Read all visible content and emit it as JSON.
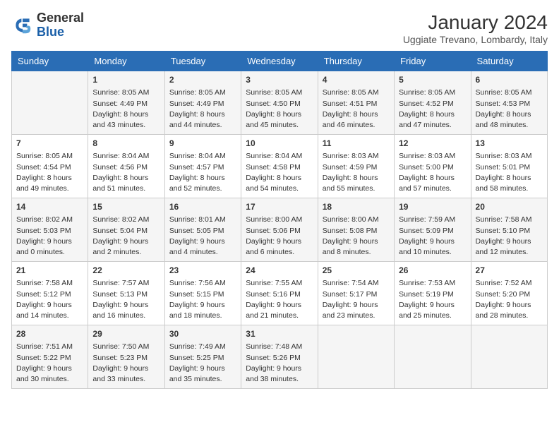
{
  "header": {
    "logo_line1": "General",
    "logo_line2": "Blue",
    "month": "January 2024",
    "location": "Uggiate Trevano, Lombardy, Italy"
  },
  "weekdays": [
    "Sunday",
    "Monday",
    "Tuesday",
    "Wednesday",
    "Thursday",
    "Friday",
    "Saturday"
  ],
  "weeks": [
    [
      {
        "day": "",
        "info": ""
      },
      {
        "day": "1",
        "info": "Sunrise: 8:05 AM\nSunset: 4:49 PM\nDaylight: 8 hours\nand 43 minutes."
      },
      {
        "day": "2",
        "info": "Sunrise: 8:05 AM\nSunset: 4:49 PM\nDaylight: 8 hours\nand 44 minutes."
      },
      {
        "day": "3",
        "info": "Sunrise: 8:05 AM\nSunset: 4:50 PM\nDaylight: 8 hours\nand 45 minutes."
      },
      {
        "day": "4",
        "info": "Sunrise: 8:05 AM\nSunset: 4:51 PM\nDaylight: 8 hours\nand 46 minutes."
      },
      {
        "day": "5",
        "info": "Sunrise: 8:05 AM\nSunset: 4:52 PM\nDaylight: 8 hours\nand 47 minutes."
      },
      {
        "day": "6",
        "info": "Sunrise: 8:05 AM\nSunset: 4:53 PM\nDaylight: 8 hours\nand 48 minutes."
      }
    ],
    [
      {
        "day": "7",
        "info": "Sunrise: 8:05 AM\nSunset: 4:54 PM\nDaylight: 8 hours\nand 49 minutes."
      },
      {
        "day": "8",
        "info": "Sunrise: 8:04 AM\nSunset: 4:56 PM\nDaylight: 8 hours\nand 51 minutes."
      },
      {
        "day": "9",
        "info": "Sunrise: 8:04 AM\nSunset: 4:57 PM\nDaylight: 8 hours\nand 52 minutes."
      },
      {
        "day": "10",
        "info": "Sunrise: 8:04 AM\nSunset: 4:58 PM\nDaylight: 8 hours\nand 54 minutes."
      },
      {
        "day": "11",
        "info": "Sunrise: 8:03 AM\nSunset: 4:59 PM\nDaylight: 8 hours\nand 55 minutes."
      },
      {
        "day": "12",
        "info": "Sunrise: 8:03 AM\nSunset: 5:00 PM\nDaylight: 8 hours\nand 57 minutes."
      },
      {
        "day": "13",
        "info": "Sunrise: 8:03 AM\nSunset: 5:01 PM\nDaylight: 8 hours\nand 58 minutes."
      }
    ],
    [
      {
        "day": "14",
        "info": "Sunrise: 8:02 AM\nSunset: 5:03 PM\nDaylight: 9 hours\nand 0 minutes."
      },
      {
        "day": "15",
        "info": "Sunrise: 8:02 AM\nSunset: 5:04 PM\nDaylight: 9 hours\nand 2 minutes."
      },
      {
        "day": "16",
        "info": "Sunrise: 8:01 AM\nSunset: 5:05 PM\nDaylight: 9 hours\nand 4 minutes."
      },
      {
        "day": "17",
        "info": "Sunrise: 8:00 AM\nSunset: 5:06 PM\nDaylight: 9 hours\nand 6 minutes."
      },
      {
        "day": "18",
        "info": "Sunrise: 8:00 AM\nSunset: 5:08 PM\nDaylight: 9 hours\nand 8 minutes."
      },
      {
        "day": "19",
        "info": "Sunrise: 7:59 AM\nSunset: 5:09 PM\nDaylight: 9 hours\nand 10 minutes."
      },
      {
        "day": "20",
        "info": "Sunrise: 7:58 AM\nSunset: 5:10 PM\nDaylight: 9 hours\nand 12 minutes."
      }
    ],
    [
      {
        "day": "21",
        "info": "Sunrise: 7:58 AM\nSunset: 5:12 PM\nDaylight: 9 hours\nand 14 minutes."
      },
      {
        "day": "22",
        "info": "Sunrise: 7:57 AM\nSunset: 5:13 PM\nDaylight: 9 hours\nand 16 minutes."
      },
      {
        "day": "23",
        "info": "Sunrise: 7:56 AM\nSunset: 5:15 PM\nDaylight: 9 hours\nand 18 minutes."
      },
      {
        "day": "24",
        "info": "Sunrise: 7:55 AM\nSunset: 5:16 PM\nDaylight: 9 hours\nand 21 minutes."
      },
      {
        "day": "25",
        "info": "Sunrise: 7:54 AM\nSunset: 5:17 PM\nDaylight: 9 hours\nand 23 minutes."
      },
      {
        "day": "26",
        "info": "Sunrise: 7:53 AM\nSunset: 5:19 PM\nDaylight: 9 hours\nand 25 minutes."
      },
      {
        "day": "27",
        "info": "Sunrise: 7:52 AM\nSunset: 5:20 PM\nDaylight: 9 hours\nand 28 minutes."
      }
    ],
    [
      {
        "day": "28",
        "info": "Sunrise: 7:51 AM\nSunset: 5:22 PM\nDaylight: 9 hours\nand 30 minutes."
      },
      {
        "day": "29",
        "info": "Sunrise: 7:50 AM\nSunset: 5:23 PM\nDaylight: 9 hours\nand 33 minutes."
      },
      {
        "day": "30",
        "info": "Sunrise: 7:49 AM\nSunset: 5:25 PM\nDaylight: 9 hours\nand 35 minutes."
      },
      {
        "day": "31",
        "info": "Sunrise: 7:48 AM\nSunset: 5:26 PM\nDaylight: 9 hours\nand 38 minutes."
      },
      {
        "day": "",
        "info": ""
      },
      {
        "day": "",
        "info": ""
      },
      {
        "day": "",
        "info": ""
      }
    ]
  ]
}
